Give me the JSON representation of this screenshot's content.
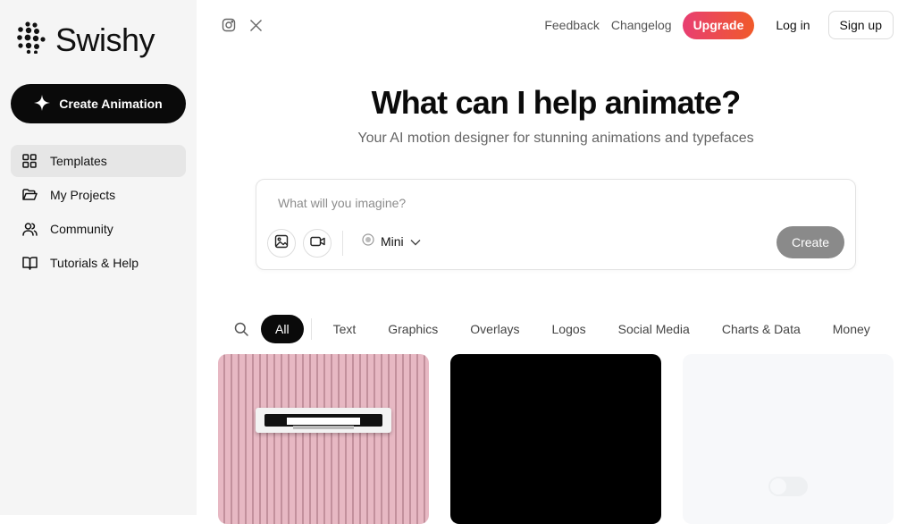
{
  "brand": {
    "name": "Swishy"
  },
  "sidebar": {
    "create_label": "Create Animation",
    "items": [
      {
        "label": "Templates",
        "icon": "grid-icon",
        "active": true
      },
      {
        "label": "My Projects",
        "icon": "folder-icon"
      },
      {
        "label": "Community",
        "icon": "users-icon"
      },
      {
        "label": "Tutorials & Help",
        "icon": "book-icon"
      }
    ]
  },
  "header": {
    "social": [
      "instagram-icon",
      "x-icon"
    ],
    "feedback": "Feedback",
    "changelog": "Changelog",
    "upgrade": "Upgrade",
    "login": "Log in",
    "signup": "Sign up"
  },
  "hero": {
    "title": "What can I help animate?",
    "subtitle": "Your AI motion designer for stunning animations and typefaces"
  },
  "prompt": {
    "placeholder": "What will you imagine?",
    "value": "",
    "model": "Mini",
    "create_label": "Create"
  },
  "filters": {
    "active": "All",
    "categories": [
      "All",
      "Text",
      "Graphics",
      "Overlays",
      "Logos",
      "Social Media",
      "Charts & Data",
      "Money"
    ]
  },
  "colors": {
    "accent_dark": "#0a0a0a",
    "upgrade_gradient": [
      "#e83e72",
      "#f05a2a"
    ],
    "sidebar_bg": "#f5f5f5"
  }
}
